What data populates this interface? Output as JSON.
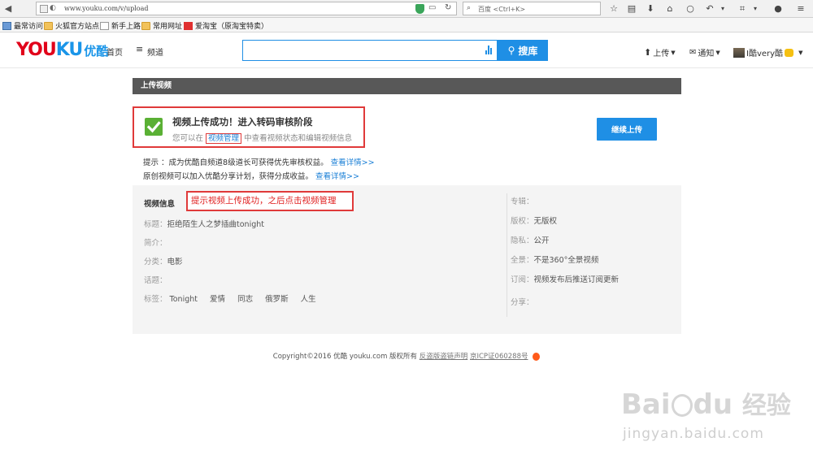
{
  "browser": {
    "url": "www.youku.com/v/upload",
    "search_placeholder": "百度 <Ctrl+K>"
  },
  "bookmarks": [
    {
      "label": "最常访问",
      "icon": "bookmark-folder-icon"
    },
    {
      "label": "火狐官方站点",
      "icon": "folder-icon"
    },
    {
      "label": "新手上路",
      "icon": "page-icon"
    },
    {
      "label": "常用网址",
      "icon": "folder-icon"
    },
    {
      "label": "爱淘宝（原淘宝特卖）",
      "icon": "taobao-icon"
    }
  ],
  "header": {
    "logo_you": "YOU",
    "logo_ku": "KU",
    "logo_cn": "优酷",
    "nav_home": "首页",
    "nav_channel": "频道",
    "search_button": "搜库",
    "upload": "上传",
    "notify": "通知",
    "user": "I酷very酷"
  },
  "panel": {
    "title": "上传视频",
    "success_title": "视频上传成功！进入转码审核阶段",
    "success_prefix": "您可以在",
    "success_link": "视频管理",
    "success_suffix": "中查看视频状态和编辑视频信息",
    "continue_button": "继续上传",
    "tip1": "提示 ：成为优酷自频道8级道长可获得优先审核权益。",
    "tip1_link": "查看详情>>",
    "tip2": "原创视频可以加入优酷分享计划，获得分成收益。",
    "tip2_link": "查看详情>>"
  },
  "info": {
    "title": "视频信息",
    "annotation": "提示视频上传成功，之后点击视频管理",
    "title_label": "标题：",
    "title_value": "拒绝陌生人之梦插曲tonight",
    "intro_label": "简介：",
    "category_label": "分类：",
    "category_value": "电影",
    "topic_label": "话题：",
    "tags_label": "标签：",
    "tags": [
      "Tonight",
      "爱情",
      "同志",
      "俄罗斯",
      "人生"
    ],
    "album_label": "专辑：",
    "copyright_label": "版权：",
    "copyright_value": "无版权",
    "privacy_label": "隐私：",
    "privacy_value": "公开",
    "panorama_label": "全景：",
    "panorama_value": "不是360°全景视频",
    "subscribe_label": "订阅：",
    "subscribe_value": "视频发布后推送订阅更新",
    "share_label": "分享："
  },
  "footer": {
    "copyright": "Copyright©2016 优酷 youku.com 版权所有",
    "notice": "反盗版盗链声明",
    "icp": "京ICP证060288号"
  },
  "watermark": {
    "brand": "Bai",
    "brand2": "du",
    "cn": "经验",
    "url": "jingyan.baidu.com"
  },
  "colors": {
    "accent": "#1f8fe5",
    "youku_red": "#e1001a",
    "highlight": "#e03a3a",
    "success": "#5ab034"
  }
}
